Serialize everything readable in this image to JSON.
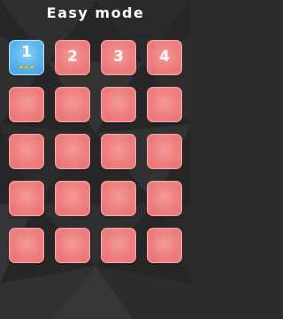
{
  "title": "Easy mode",
  "levels": [
    {
      "label": "1",
      "stars": 3,
      "state": "current"
    },
    {
      "label": "2",
      "stars": 0,
      "state": "open"
    },
    {
      "label": "3",
      "stars": 0,
      "state": "open"
    },
    {
      "label": "4",
      "stars": 0,
      "state": "open"
    },
    {
      "label": "",
      "stars": 0,
      "state": "locked"
    },
    {
      "label": "",
      "stars": 0,
      "state": "locked"
    },
    {
      "label": "",
      "stars": 0,
      "state": "locked"
    },
    {
      "label": "",
      "stars": 0,
      "state": "locked"
    },
    {
      "label": "",
      "stars": 0,
      "state": "locked"
    },
    {
      "label": "",
      "stars": 0,
      "state": "locked"
    },
    {
      "label": "",
      "stars": 0,
      "state": "locked"
    },
    {
      "label": "",
      "stars": 0,
      "state": "locked"
    },
    {
      "label": "",
      "stars": 0,
      "state": "locked"
    },
    {
      "label": "",
      "stars": 0,
      "state": "locked"
    },
    {
      "label": "",
      "stars": 0,
      "state": "locked"
    },
    {
      "label": "",
      "stars": 0,
      "state": "locked"
    },
    {
      "label": "",
      "stars": 0,
      "state": "locked"
    },
    {
      "label": "",
      "stars": 0,
      "state": "locked"
    },
    {
      "label": "",
      "stars": 0,
      "state": "locked"
    },
    {
      "label": "",
      "stars": 0,
      "state": "locked"
    }
  ],
  "colors": {
    "background": "#2b2b2b",
    "tile": "#ee7e7e",
    "current_tile": "#57b3ec",
    "star": "#f5c83c",
    "text": "#ffffff"
  },
  "icons": {
    "star": "star-icon"
  }
}
